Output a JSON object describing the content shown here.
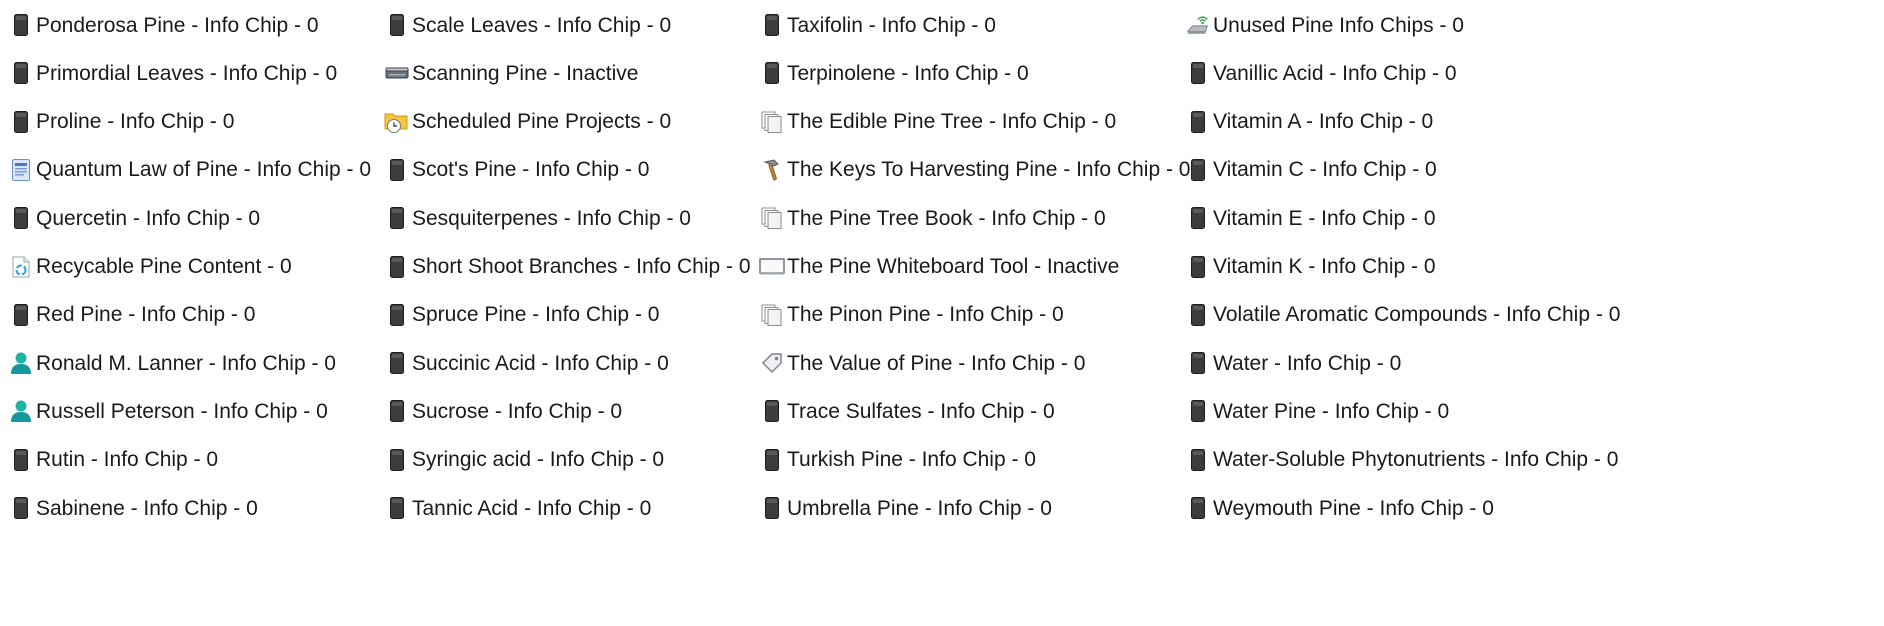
{
  "columns": [
    {
      "items": [
        {
          "label": "Ponderosa Pine - Info Chip - 0",
          "icon": "chip-icon"
        },
        {
          "label": "Primordial Leaves - Info Chip - 0",
          "icon": "chip-icon"
        },
        {
          "label": "Proline - Info Chip - 0",
          "icon": "chip-icon"
        },
        {
          "label": "Quantum Law of Pine - Info Chip - 0",
          "icon": "document-icon"
        },
        {
          "label": "Quercetin - Info Chip - 0",
          "icon": "chip-icon"
        },
        {
          "label": "Recycable Pine Content - 0",
          "icon": "recycle-icon"
        },
        {
          "label": "Red Pine - Info Chip - 0",
          "icon": "chip-icon"
        },
        {
          "label": "Ronald M. Lanner - Info Chip - 0",
          "icon": "person-icon"
        },
        {
          "label": "Russell Peterson - Info Chip - 0",
          "icon": "person-icon"
        },
        {
          "label": "Rutin - Info Chip - 0",
          "icon": "chip-icon"
        },
        {
          "label": "Sabinene - Info Chip - 0",
          "icon": "chip-icon"
        }
      ]
    },
    {
      "items": [
        {
          "label": "Scale Leaves - Info Chip - 0",
          "icon": "chip-icon"
        },
        {
          "label": "Scanning Pine - Inactive",
          "icon": "scanner-icon"
        },
        {
          "label": "Scheduled Pine Projects - 0",
          "icon": "scheduled-folder-icon"
        },
        {
          "label": "Scot's Pine - Info Chip - 0",
          "icon": "chip-icon"
        },
        {
          "label": "Sesquiterpenes - Info Chip - 0",
          "icon": "chip-icon"
        },
        {
          "label": "Short Shoot Branches - Info Chip - 0",
          "icon": "chip-icon"
        },
        {
          "label": "Spruce Pine - Info Chip - 0",
          "icon": "chip-icon"
        },
        {
          "label": "Succinic Acid - Info Chip - 0",
          "icon": "chip-icon"
        },
        {
          "label": "Sucrose - Info Chip - 0",
          "icon": "chip-icon"
        },
        {
          "label": "Syringic acid - Info Chip - 0",
          "icon": "chip-icon"
        },
        {
          "label": "Tannic Acid - Info Chip - 0",
          "icon": "chip-icon"
        }
      ]
    },
    {
      "items": [
        {
          "label": "Taxifolin - Info Chip - 0",
          "icon": "chip-icon"
        },
        {
          "label": "Terpinolene - Info Chip - 0",
          "icon": "chip-icon"
        },
        {
          "label": "The Edible Pine Tree - Info Chip - 0",
          "icon": "pages-icon"
        },
        {
          "label": "The Keys To Harvesting Pine - Info Chip - 0",
          "icon": "hammer-icon"
        },
        {
          "label": "The Pine Tree Book - Info Chip - 0",
          "icon": "pages-icon"
        },
        {
          "label": "The Pine Whiteboard Tool - Inactive",
          "icon": "whiteboard-icon"
        },
        {
          "label": "The Pinon Pine - Info Chip - 0",
          "icon": "pages-icon"
        },
        {
          "label": "The Value of Pine - Info Chip - 0",
          "icon": "tag-icon"
        },
        {
          "label": "Trace Sulfates - Info Chip - 0",
          "icon": "chip-icon"
        },
        {
          "label": "Turkish Pine - Info Chip - 0",
          "icon": "chip-icon"
        },
        {
          "label": "Umbrella Pine - Info Chip - 0",
          "icon": "chip-icon"
        }
      ]
    },
    {
      "items": [
        {
          "label": "Unused Pine Info Chips - 0",
          "icon": "wireless-drive-icon"
        },
        {
          "label": "Vanillic Acid - Info Chip - 0",
          "icon": "chip-icon"
        },
        {
          "label": "Vitamin A - Info Chip - 0",
          "icon": "chip-icon"
        },
        {
          "label": "Vitamin C - Info Chip - 0",
          "icon": "chip-icon"
        },
        {
          "label": "Vitamin E - Info Chip - 0",
          "icon": "chip-icon"
        },
        {
          "label": "Vitamin K - Info Chip - 0",
          "icon": "chip-icon"
        },
        {
          "label": "Volatile Aromatic Compounds - Info Chip - 0",
          "icon": "chip-icon"
        },
        {
          "label": "Water - Info Chip - 0",
          "icon": "chip-icon"
        },
        {
          "label": "Water Pine - Info Chip - 0",
          "icon": "chip-icon"
        },
        {
          "label": "Water-Soluble Phytonutrients - Info Chip - 0",
          "icon": "chip-icon"
        },
        {
          "label": "Weymouth Pine - Info Chip - 0",
          "icon": "chip-icon"
        }
      ]
    }
  ]
}
